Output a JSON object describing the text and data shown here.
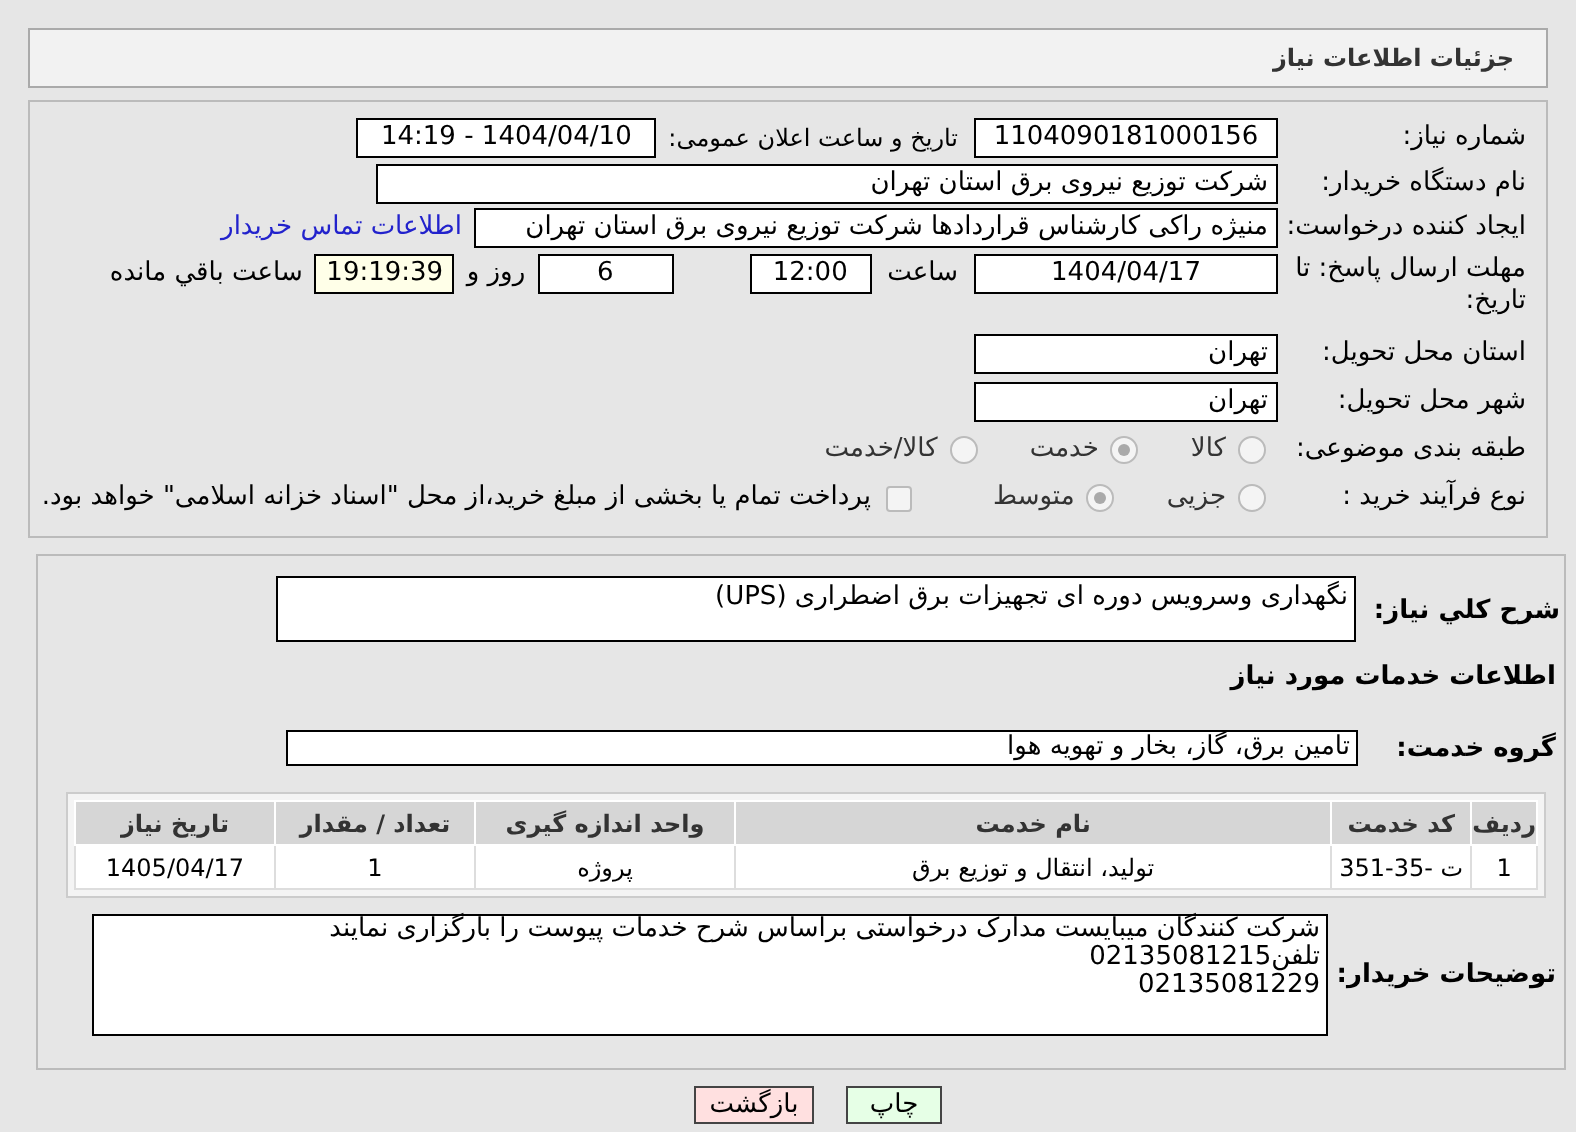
{
  "header": {
    "title": "جزئیات اطلاعات نیاز"
  },
  "need_number": {
    "label": "شماره نیاز:",
    "value": "1104090181000156"
  },
  "announce": {
    "label": "تاریخ و ساعت اعلان عمومی:",
    "value": "1404/04/10 - 14:19"
  },
  "buyer_org": {
    "label": "نام دستگاه خریدار:",
    "value": "شرکت توزیع نیروی برق استان تهران"
  },
  "creator": {
    "label": "ایجاد کننده درخواست:",
    "value": "منیژه راکی کارشناس قراردادها شرکت توزیع نیروی برق استان تهران",
    "link": "اطلاعات تماس خریدار"
  },
  "deadline": {
    "label": "مهلت ارسال پاسخ: تا تاریخ:",
    "date": "1404/04/17",
    "time_label": "ساعت",
    "time": "12:00",
    "days": "6",
    "days_label": "روز و",
    "remaining": "19:19:39",
    "remaining_label": "ساعت باقي مانده"
  },
  "province": {
    "label": "استان محل تحویل:",
    "value": "تهران"
  },
  "city": {
    "label": "شهر محل تحویل:",
    "value": "تهران"
  },
  "category": {
    "label": "طبقه بندی موضوعی:",
    "options": [
      {
        "label": "کالا",
        "selected": false
      },
      {
        "label": "خدمت",
        "selected": true
      },
      {
        "label": "کالا/خدمت",
        "selected": false
      }
    ]
  },
  "process": {
    "label": "نوع فرآیند خرید :",
    "options": [
      {
        "label": "جزیی",
        "selected": false
      },
      {
        "label": "متوسط",
        "selected": true
      }
    ],
    "payment": {
      "checked": false,
      "text": "پرداخت تمام یا بخشی از مبلغ خرید،از محل \"اسناد خزانه اسلامی\" خواهد بود."
    }
  },
  "summary": {
    "label": "شرح كلي نياز:",
    "value": "نگهداری وسرویس دوره ای تجهیزات برق اضطراری (UPS)"
  },
  "services_heading": "اطلاعات خدمات مورد نياز",
  "service_group": {
    "label": "گروه خدمت:",
    "value": "تامین برق، گاز، بخار و تهویه هوا"
  },
  "table": {
    "columns": [
      "ردیف",
      "کد خدمت",
      "نام خدمت",
      "واحد اندازه گیری",
      "تعداد / مقدار",
      "تاریخ نیاز"
    ],
    "rows": [
      [
        "1",
        "ت -35-351",
        "تولید، انتقال و توزیع برق",
        "پروژه",
        "1",
        "1405/04/17"
      ]
    ]
  },
  "buyer_notes": {
    "label": "توضیحات خریدار:",
    "lines": [
      "شرکت کنندگان میبایست مدارک درخواستی براساس شرح خدمات پیوست را بارگزاری نمایند",
      "تلفن02135081215",
      "02135081229"
    ]
  },
  "buttons": [
    {
      "label": "چاپ",
      "kind": "print"
    },
    {
      "label": "بازگشت",
      "kind": "back"
    }
  ]
}
